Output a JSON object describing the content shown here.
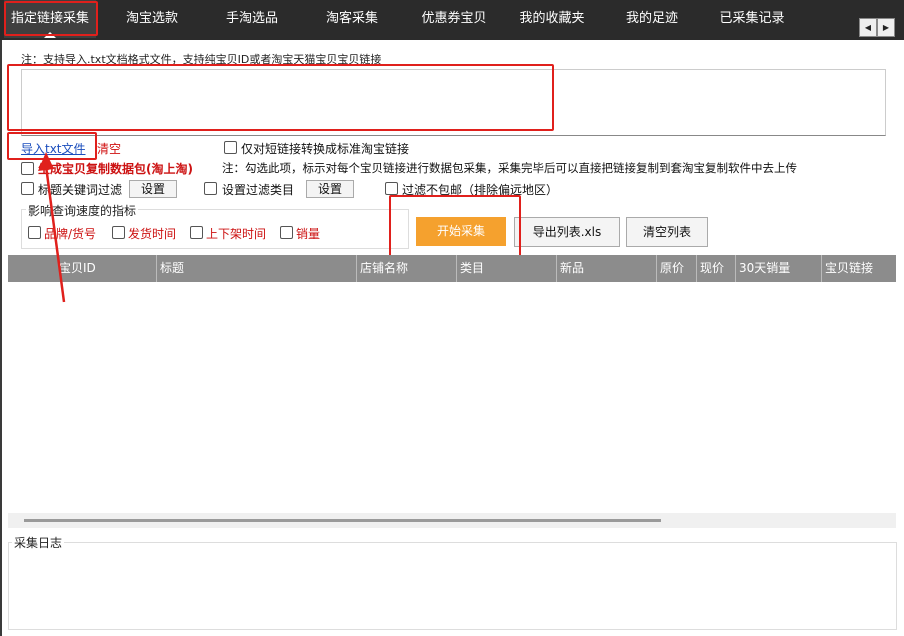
{
  "tabs": [
    {
      "label": "指定链接采集",
      "active": true
    },
    {
      "label": "淘宝选款",
      "active": false
    },
    {
      "label": "手淘选品",
      "active": false
    },
    {
      "label": "淘客采集",
      "active": false
    },
    {
      "label": "优惠券宝贝",
      "active": false
    },
    {
      "label": "我的收藏夹",
      "active": false
    },
    {
      "label": "我的足迹",
      "active": false
    },
    {
      "label": "已采集记录",
      "active": false
    }
  ],
  "tab_scroll": {
    "left": "◀",
    "right": "▶"
  },
  "input_note": "注：支持导入.txt文档格式文件，支持纯宝贝ID或者淘宝天猫宝贝宝贝链接",
  "link_input_value": "",
  "import_txt_label": "导入txt文件",
  "clear_label": "清空",
  "options": {
    "short_link_convert": {
      "label": "仅对短链接转换成标准淘宝链接",
      "checked": false
    },
    "generate_package": {
      "label": "生成宝贝复制数据包(淘上淘)",
      "checked": false
    },
    "package_note": "注：勾选此项，标示对每个宝贝链接进行数据包采集，采集完毕后可以直接把链接复制到套淘宝复制软件中去上传",
    "title_keyword_filter": {
      "label": "标题关键词过滤",
      "checked": false
    },
    "title_keyword_setting": "设置",
    "category_filter": {
      "label": "设置过滤类目",
      "checked": false
    },
    "category_setting": "设置",
    "no_free_shipping_filter": {
      "label": "过滤不包邮（排除偏远地区）",
      "checked": false
    }
  },
  "speed_group": {
    "title": "影响查询速度的指标",
    "items": [
      {
        "label": "品牌/货号",
        "checked": false
      },
      {
        "label": "发货时间",
        "checked": false
      },
      {
        "label": "上下架时间",
        "checked": false
      },
      {
        "label": "销量",
        "checked": false
      }
    ]
  },
  "actions": {
    "start": "开始采集",
    "export": "导出列表.xls",
    "clear_list": "清空列表"
  },
  "table": {
    "columns": [
      "宝贝ID",
      "标题",
      "店铺名称",
      "类目",
      "新品",
      "原价",
      "现价",
      "30天销量",
      "宝贝链接"
    ],
    "rows": []
  },
  "log": {
    "title": "采集日志",
    "content": ""
  },
  "colors": {
    "accent_orange": "#f5a12e",
    "annotation_red": "#e0201c",
    "tabbar_bg": "#2b2b2b",
    "header_gray": "#8c8c8c"
  }
}
